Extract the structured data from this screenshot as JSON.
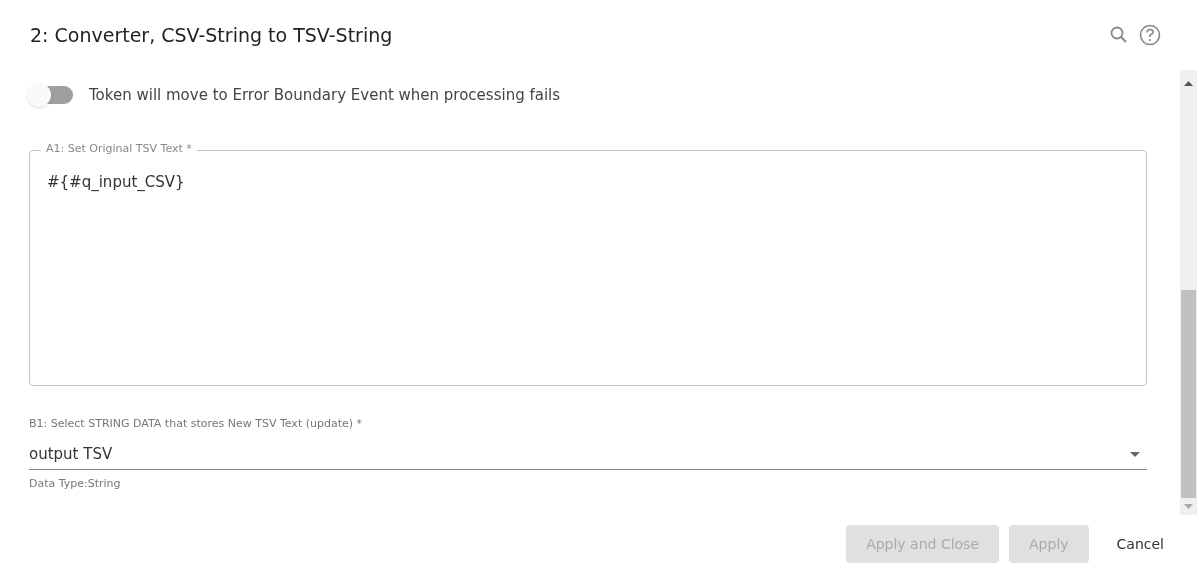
{
  "dialog": {
    "title": "2: Converter, CSV-String to TSV-String"
  },
  "toggle": {
    "label": "Token will move to Error Boundary Event when processing fails",
    "on": false
  },
  "text_area": {
    "label": "A1: Set Original TSV Text *",
    "value": "#{#q_input_CSV}"
  },
  "select": {
    "label": "B1: Select STRING DATA that stores New TSV Text (update) *",
    "value": "output TSV",
    "helper": "Data Type:String"
  },
  "buttons": [
    {
      "label": "Apply and Close",
      "kind": "filled",
      "disabled": true
    },
    {
      "label": "Apply",
      "kind": "filled",
      "disabled": true
    },
    {
      "label": "Cancel",
      "kind": "text",
      "disabled": false
    }
  ]
}
